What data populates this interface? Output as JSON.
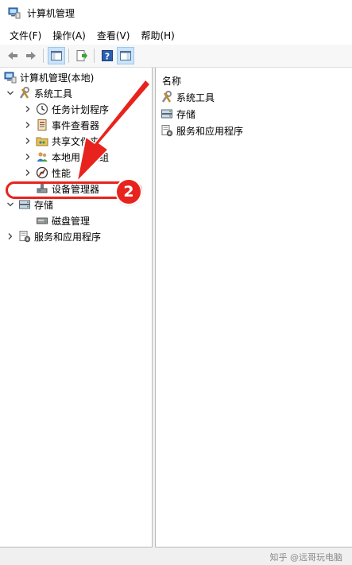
{
  "window": {
    "title": "计算机管理",
    "icon": "computer-management-icon"
  },
  "menubar": [
    {
      "label": "文件(F)"
    },
    {
      "label": "操作(A)"
    },
    {
      "label": "查看(V)"
    },
    {
      "label": "帮助(H)"
    }
  ],
  "toolbar": {
    "buttons": [
      "back-icon",
      "forward-icon",
      "show-hide-console-tree-icon",
      "export-list-icon",
      "help-icon",
      "show-action-pane-icon"
    ]
  },
  "tree": {
    "root": {
      "label": "计算机管理(本地)",
      "icon": "computer-management-icon",
      "expanded": true
    },
    "items": [
      {
        "label": "系统工具",
        "icon": "system-tools-icon",
        "expanded": true
      },
      {
        "label": "任务计划程序",
        "icon": "clock-icon"
      },
      {
        "label": "事件查看器",
        "icon": "event-viewer-icon"
      },
      {
        "label": "共享文件夹",
        "icon": "shared-folder-icon"
      },
      {
        "label": "本地用户和组",
        "icon": "users-icon"
      },
      {
        "label": "性能",
        "icon": "performance-icon"
      },
      {
        "label": "设备管理器",
        "icon": "device-manager-icon",
        "highlighted": true
      },
      {
        "label": "存储",
        "icon": "storage-icon",
        "expanded": true
      },
      {
        "label": "磁盘管理",
        "icon": "disk-management-icon"
      },
      {
        "label": "服务和应用程序",
        "icon": "services-icon"
      }
    ]
  },
  "list": {
    "column_header": "名称",
    "items": [
      {
        "label": "系统工具",
        "icon": "system-tools-icon"
      },
      {
        "label": "存储",
        "icon": "storage-icon"
      },
      {
        "label": "服务和应用程序",
        "icon": "services-icon"
      }
    ]
  },
  "annotation": {
    "step_number": "2",
    "color": "#e8231d"
  },
  "watermark": "知乎 @远哥玩电脑",
  "colors": {
    "accent": "#e8231d",
    "selection": "#cce4f7"
  }
}
